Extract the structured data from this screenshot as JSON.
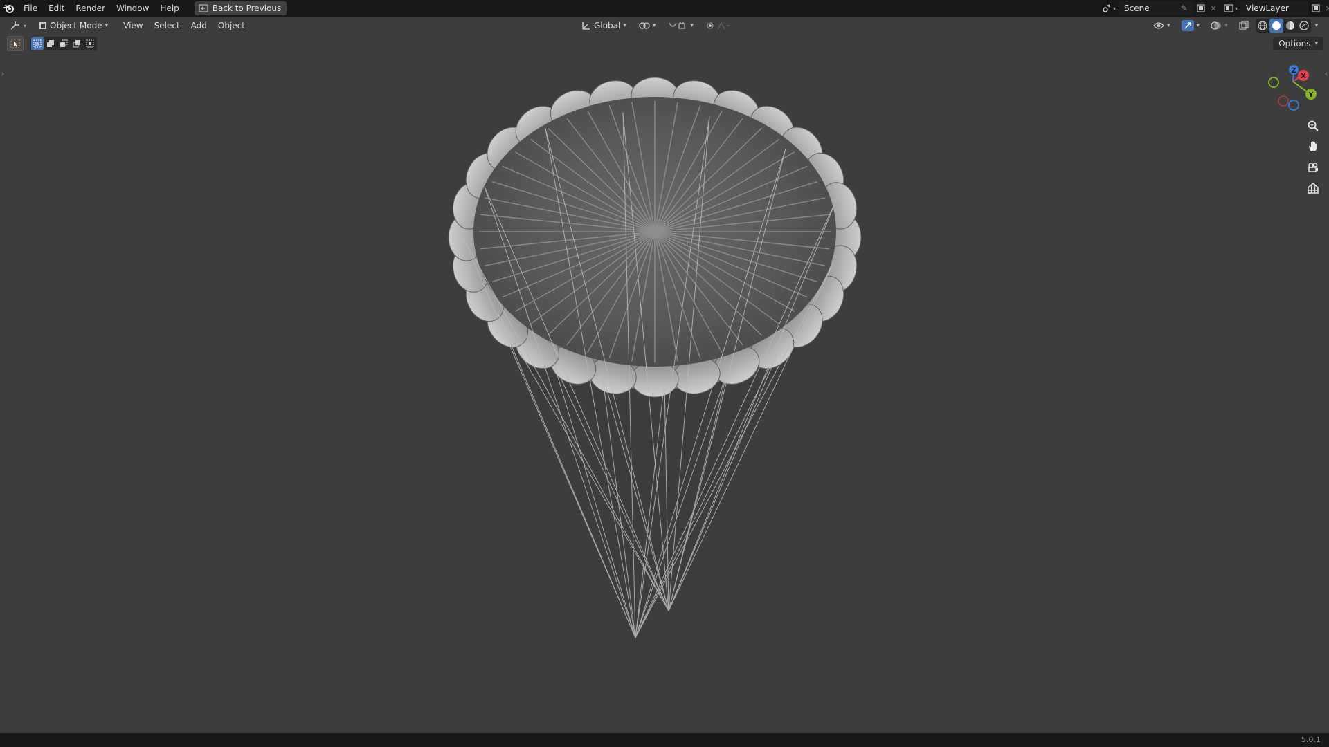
{
  "topbar": {
    "menu": [
      "File",
      "Edit",
      "Render",
      "Window",
      "Help"
    ],
    "back_label": "Back to Previous",
    "scene_name": "Scene",
    "view_layer_name": "ViewLayer"
  },
  "viewport_header": {
    "mode_label": "Object Mode",
    "menus": [
      "View",
      "Select",
      "Add",
      "Object"
    ],
    "orientation_label": "Global"
  },
  "toolbar": {
    "options_label": "Options"
  },
  "gizmo": {
    "x_label": "X",
    "y_label": "Y",
    "z_label": "Z",
    "x_color": "#e0434e",
    "y_color": "#8ab32e",
    "z_color": "#3b7bd8"
  },
  "icons": [
    "blender-logo-icon",
    "back-icon",
    "editor-type-icon",
    "object-mode-icon",
    "transform-orientation-icon",
    "pivot-icon",
    "snap-icon",
    "proportional-edit-icon",
    "visibility-icon",
    "gizmo-icon",
    "overlay-icon",
    "xray-icon",
    "wireframe-shading-icon",
    "solid-shading-icon",
    "material-shading-icon",
    "rendered-shading-icon",
    "zoom-icon",
    "hand-pan-icon",
    "camera-icon",
    "grid-icon"
  ],
  "accent_color": "#4772b3",
  "status": {
    "version": "5.0.1"
  }
}
